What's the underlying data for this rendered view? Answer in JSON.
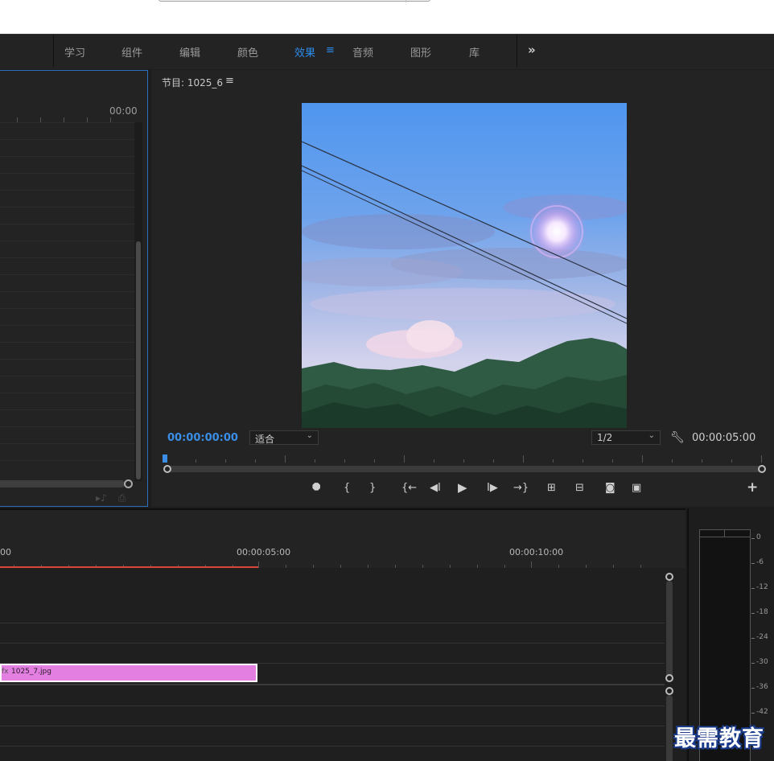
{
  "workspace": {
    "tabs": [
      {
        "label": "学习"
      },
      {
        "label": "组件"
      },
      {
        "label": "编辑"
      },
      {
        "label": "颜色"
      },
      {
        "label": "效果",
        "active": true
      },
      {
        "label": "音频"
      },
      {
        "label": "图形"
      },
      {
        "label": "库"
      }
    ],
    "menu_icon": "hamburger-icon",
    "more_icon": "double-chevron-right-icon",
    "more_label": "»"
  },
  "source_panel": {
    "timecode": "00:00"
  },
  "program_monitor": {
    "title": "节目: 1025_6",
    "menu_icon": "hamburger-icon",
    "current_time": "00:00:00:00",
    "zoom_select": "适合",
    "resolution_select": "1/2",
    "settings_icon": "wrench-icon",
    "duration": "00:00:05:00",
    "controls": [
      {
        "name": "add-marker-button",
        "icon": "marker-icon",
        "glyph": "⯃"
      },
      {
        "name": "mark-in-button",
        "icon": "mark-in-icon",
        "glyph": "{"
      },
      {
        "name": "mark-out-button",
        "icon": "mark-out-icon",
        "glyph": "}"
      },
      {
        "name": "go-to-in-button",
        "icon": "go-to-in-icon",
        "glyph": "{←"
      },
      {
        "name": "step-back-button",
        "icon": "step-back-icon",
        "glyph": "◀I"
      },
      {
        "name": "play-button",
        "icon": "play-icon",
        "glyph": "▶"
      },
      {
        "name": "step-forward-button",
        "icon": "step-forward-icon",
        "glyph": "I▶"
      },
      {
        "name": "go-to-out-button",
        "icon": "go-to-out-icon",
        "glyph": "→}"
      },
      {
        "name": "lift-button",
        "icon": "lift-icon",
        "glyph": "⊞"
      },
      {
        "name": "extract-button",
        "icon": "extract-icon",
        "glyph": "⊟"
      },
      {
        "name": "export-frame-button",
        "icon": "camera-icon",
        "glyph": "◙"
      },
      {
        "name": "compare-view-button",
        "icon": "compare-icon",
        "glyph": "▣"
      },
      {
        "name": "button-editor-button",
        "icon": "plus-icon",
        "glyph": "+"
      }
    ]
  },
  "timeline": {
    "timecodes": [
      "00",
      "00:00:05:00",
      "00:00:10:00"
    ],
    "clip": {
      "label": "1025_7.jpg",
      "color": "#e37fe0",
      "fx_icon": "fx-icon"
    }
  },
  "audio_meter": {
    "scale": [
      "0",
      "-6",
      "-12",
      "-18",
      "-24",
      "-30",
      "-36",
      "-42"
    ]
  },
  "watermark": "最需教育",
  "colors": {
    "accent": "#2d8ceb",
    "timecode": "#3a8ee6",
    "work_area_bar": "#d8463a",
    "clip": "#e37fe0",
    "panel_focus_border": "#2f6fbf"
  }
}
